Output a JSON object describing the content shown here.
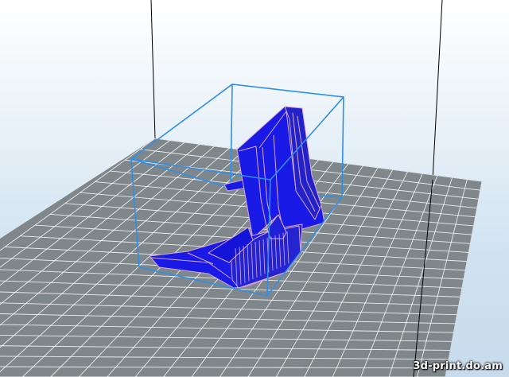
{
  "watermark": {
    "text": "3d-print.do.am"
  },
  "colors": {
    "build_plate": "#7f878b",
    "grid_line": "#ffffff",
    "bounding_box": "#2f8fe8",
    "model_fill": "#1a1ae6",
    "model_edge": "#d8a8d8",
    "printer_frame": "#000000"
  },
  "icons": {
    "model": "3d-model",
    "plate": "build-plate-grid"
  }
}
